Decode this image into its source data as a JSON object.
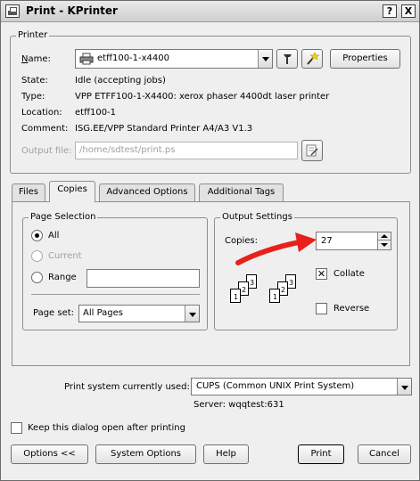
{
  "window": {
    "title": "Print - KPrinter",
    "help_label": "?",
    "close_label": "X"
  },
  "printer": {
    "group_title": "Printer",
    "name_label": "Name:",
    "name_value": "etff100-1-x4400",
    "properties_label": "Properties",
    "state_label": "State:",
    "state_value": "Idle (accepting jobs)",
    "type_label": "Type:",
    "type_value": "VPP ETFF100-1-X4400: xerox phaser 4400dt laser printer",
    "location_label": "Location:",
    "location_value": "etff100-1",
    "comment_label": "Comment:",
    "comment_value": "ISG.EE/VPP Standard Printer A4/A3 V1.3",
    "output_file_label": "Output file:",
    "output_file_value": "/home/sdtest/print.ps"
  },
  "tabs": [
    {
      "label": "Files",
      "active": false
    },
    {
      "label": "Copies",
      "active": true
    },
    {
      "label": "Advanced Options",
      "active": false
    },
    {
      "label": "Additional Tags",
      "active": false
    }
  ],
  "page_selection": {
    "group_title": "Page Selection",
    "all_label": "All",
    "current_label": "Current",
    "range_label": "Range",
    "range_value": "",
    "page_set_label": "Page set:",
    "page_set_value": "All Pages",
    "selected": "All"
  },
  "output_settings": {
    "group_title": "Output Settings",
    "copies_label": "Copies:",
    "copies_value": "27",
    "collate_label": "Collate",
    "collate_checked": true,
    "reverse_label": "Reverse",
    "reverse_checked": false,
    "page_numbers": [
      "1",
      "2",
      "3"
    ]
  },
  "print_system": {
    "label": "Print system currently used:",
    "value": "CUPS (Common UNIX Print System)",
    "server_text": "Server: wqqtest:631"
  },
  "keep_open": {
    "label": "Keep this dialog open after printing",
    "checked": false
  },
  "buttons": {
    "options": "Options <<",
    "system_options": "System Options",
    "help": "Help",
    "print": "Print",
    "cancel": "Cancel"
  },
  "annotation": {
    "arrow_color": "#e8201a"
  }
}
